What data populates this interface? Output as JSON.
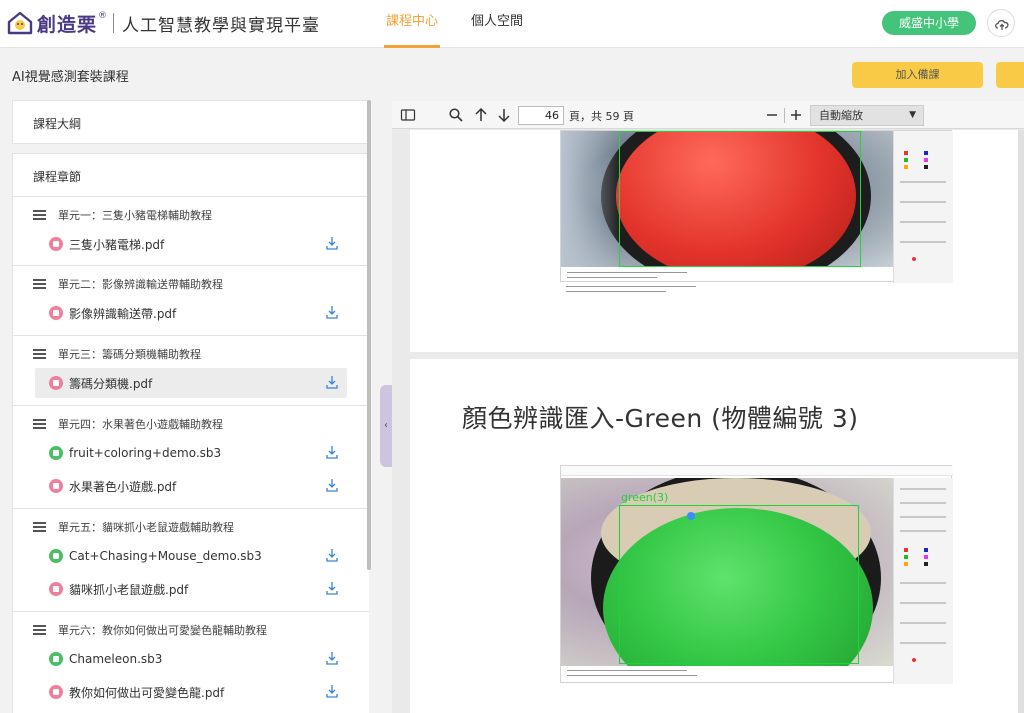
{
  "brand": {
    "name": "創造栗",
    "reg": "®",
    "subtitle": "人工智慧教學與實現平臺"
  },
  "nav": {
    "tabs": [
      {
        "label": "課程中心",
        "active": true
      },
      {
        "label": "個人空間",
        "active": false
      }
    ],
    "school": "威盛中小學",
    "cloud_icon": "cloud-upload-icon"
  },
  "course": {
    "title": "AI視覺感測套裝課程",
    "join_label": "加入備課"
  },
  "sidebar": {
    "outline_label": "課程大綱",
    "chapters_label": "課程章節",
    "units": [
      {
        "title": "單元一：三隻小豬電梯輔助教程",
        "files": [
          {
            "name": "三隻小豬電梯.pdf",
            "type": "pdf"
          }
        ]
      },
      {
        "title": "單元二：影像辨識輸送帶輔助教程",
        "files": [
          {
            "name": "影像辨識輸送帶.pdf",
            "type": "pdf"
          }
        ]
      },
      {
        "title": "單元三：籌碼分類機輔助教程",
        "files": [
          {
            "name": "籌碼分類機.pdf",
            "type": "pdf",
            "selected": true
          }
        ]
      },
      {
        "title": "單元四：水果著色小遊戲輔助教程",
        "files": [
          {
            "name": "fruit+coloring+demo.sb3",
            "type": "sb3"
          },
          {
            "name": "水果著色小遊戲.pdf",
            "type": "pdf"
          }
        ]
      },
      {
        "title": "單元五：貓咪抓小老鼠遊戲輔助教程",
        "files": [
          {
            "name": "Cat+Chasing+Mouse_demo.sb3",
            "type": "sb3"
          },
          {
            "name": "貓咪抓小老鼠遊戲.pdf",
            "type": "pdf"
          }
        ]
      },
      {
        "title": "單元六：教你如何做出可愛變色龍輔助教程",
        "files": [
          {
            "name": "Chameleon.sb3",
            "type": "sb3"
          },
          {
            "name": "教你如何做出可愛變色龍.pdf",
            "type": "pdf"
          }
        ]
      }
    ]
  },
  "viewer": {
    "page_value": "46",
    "page_total_label": "頁，共 59 頁",
    "zoom_label": "自動縮放",
    "slide_title": "顏色辨識匯入-Green (物體編號 3)",
    "detect_label": "green(3)"
  },
  "colors": {
    "accent": "#f2a33a",
    "school_btn": "#43c47a",
    "join_btn": "#f8ca45",
    "brand": "#4a3a86"
  }
}
